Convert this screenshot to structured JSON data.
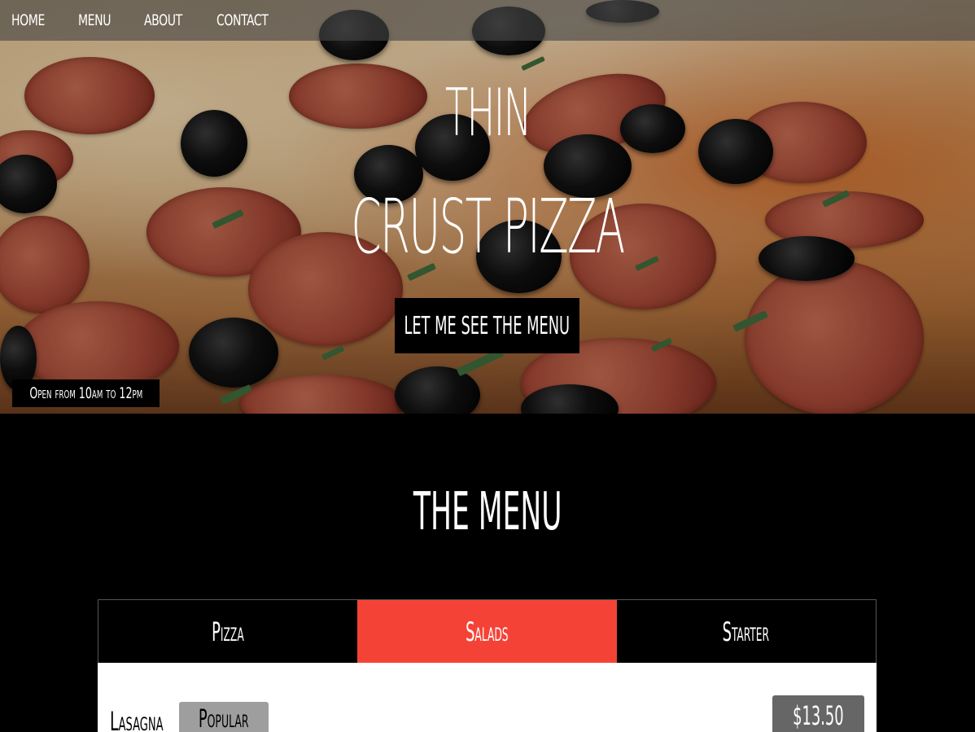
{
  "nav": {
    "items": [
      "Home",
      "Menu",
      "About",
      "Contact"
    ]
  },
  "hero": {
    "title_line1": "Thin",
    "title_line2": "Crust Pizza",
    "cta_label": "Let me see the menu",
    "hours": "Open from 10am to 12pm"
  },
  "menu": {
    "title": "The Menu",
    "tabs": [
      {
        "label": "Pizza",
        "active": false
      },
      {
        "label": "Salads",
        "active": true
      },
      {
        "label": "Starter",
        "active": false
      }
    ],
    "items": [
      {
        "name": "Lasagna",
        "badge": "Popular",
        "price": "$13.50"
      }
    ]
  },
  "colors": {
    "accent": "#f44336",
    "background": "#000000",
    "panel": "#ffffff",
    "badge": "#9e9e9e",
    "price_tag": "#666666"
  }
}
